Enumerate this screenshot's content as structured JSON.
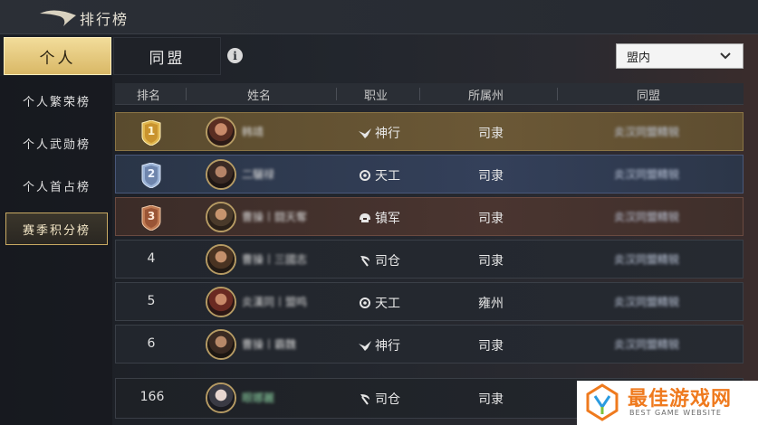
{
  "header": {
    "title": "排行榜"
  },
  "tabs": {
    "personal": "个人",
    "alliance": "同盟"
  },
  "scope": {
    "selected": "盟内"
  },
  "sidebar": {
    "items": [
      {
        "label": "个人繁荣榜"
      },
      {
        "label": "个人武勋榜"
      },
      {
        "label": "个人首占榜"
      },
      {
        "label": "赛季积分榜"
      }
    ]
  },
  "table": {
    "headers": [
      "排名",
      "姓名",
      "职业",
      "所属州",
      "同盟"
    ],
    "rows": [
      {
        "rank": "1",
        "name": "韩靖",
        "profession": "神行",
        "prof_icon": "wing-icon",
        "state": "司隶",
        "alliance": "炎汉同盟精锐"
      },
      {
        "rank": "2",
        "name": "二驪禄",
        "profession": "天工",
        "prof_icon": "gear-icon",
        "state": "司隶",
        "alliance": "炎汉同盟精锐"
      },
      {
        "rank": "3",
        "name": "曹操丨闘天奪",
        "profession": "镇军",
        "prof_icon": "helmet-icon",
        "state": "司隶",
        "alliance": "炎汉同盟精锐"
      },
      {
        "rank": "4",
        "name": "曹操丨三國志",
        "profession": "司仓",
        "prof_icon": "sickle-icon",
        "state": "司隶",
        "alliance": "炎汉同盟精锐"
      },
      {
        "rank": "5",
        "name": "炎漢同丨盟鸣",
        "profession": "天工",
        "prof_icon": "gear-icon",
        "state": "雍州",
        "alliance": "炎汉同盟精锐"
      },
      {
        "rank": "6",
        "name": "曹操丨霸魏",
        "profession": "神行",
        "prof_icon": "wing-icon",
        "state": "司隶",
        "alliance": "炎汉同盟精锐"
      }
    ],
    "self": {
      "rank": "166",
      "name": "眼娜麗",
      "profession": "司仓",
      "prof_icon": "sickle-icon",
      "state": "司隶"
    }
  },
  "watermark": {
    "text": "最佳游戏网",
    "sub": "BEST GAME WEBSITE"
  },
  "colors": {
    "gold": "#d9b866",
    "silver": "#8fa6c9",
    "bronze": "#b06a45",
    "accent_text": "#e8e3d6"
  }
}
